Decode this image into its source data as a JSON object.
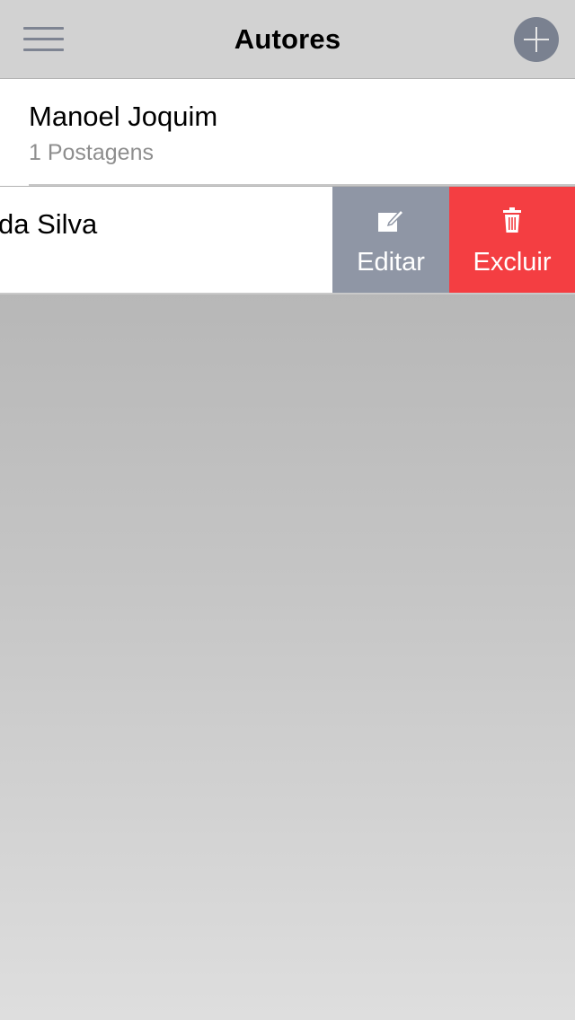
{
  "header": {
    "title": "Autores",
    "menu_icon": "hamburger-menu-icon",
    "add_icon": "plus-circle-icon"
  },
  "authors": [
    {
      "name": "Manoel Joquim",
      "posts": "1 Postagens"
    },
    {
      "name_visible": "da Silva",
      "actions": {
        "edit_label": "Editar",
        "edit_icon": "edit-icon",
        "delete_label": "Excluir",
        "delete_icon": "trash-icon"
      }
    }
  ],
  "colors": {
    "navbar_bg": "#d2d2d2",
    "edit_bg": "#8f96a5",
    "delete_bg": "#f43e42",
    "icon_gray": "#7a8190"
  }
}
